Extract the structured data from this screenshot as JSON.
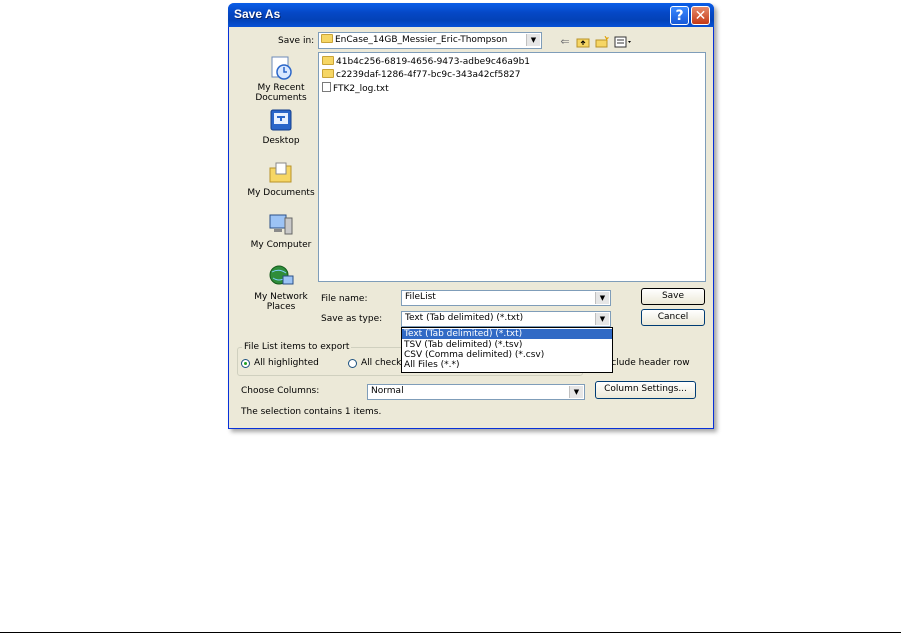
{
  "dialog": {
    "title": "Save As",
    "help_glyph": "?",
    "close_glyph": "✕"
  },
  "toolbar": {
    "save_in_label": "Save in:",
    "save_in_value": "EnCase_14GB_Messier_Eric-Thompson",
    "back_icon": "back-arrow-icon",
    "up_icon": "up-folder-icon",
    "new_folder_icon": "new-folder-icon",
    "views_icon": "views-menu-icon"
  },
  "places": [
    {
      "label": "My Recent Documents",
      "icon": "recent-documents-icon"
    },
    {
      "label": "Desktop",
      "icon": "desktop-icon"
    },
    {
      "label": "My Documents",
      "icon": "my-documents-icon"
    },
    {
      "label": "My Computer",
      "icon": "my-computer-icon"
    },
    {
      "label": "My Network Places",
      "icon": "network-places-icon"
    }
  ],
  "files": [
    {
      "name": "41b4c256-6819-4656-9473-adbe9c46a9b1",
      "type": "folder"
    },
    {
      "name": "c2239daf-1286-4f77-bc9c-343a42cf5827",
      "type": "folder"
    },
    {
      "name": "FTK2_log.txt",
      "type": "text"
    }
  ],
  "file_name": {
    "label": "File name:",
    "value": "FileList"
  },
  "save_as_type": {
    "label": "Save as type:",
    "value": "Text (Tab delimited) (*.txt)",
    "options": [
      "Text (Tab delimited) (*.txt)",
      "TSV (Tab delimited) (*.tsv)",
      "CSV (Comma delimited) (*.csv)",
      "All Files (*.*)"
    ],
    "selected_index": 0
  },
  "buttons": {
    "save": "Save",
    "cancel": "Cancel",
    "column_settings": "Column Settings..."
  },
  "export_group": {
    "legend": "File List items to export",
    "radio_highlighted": "All highlighted",
    "radio_checked": "All checke",
    "include_header": "Include header row"
  },
  "columns": {
    "label": "Choose Columns:",
    "value": "Normal"
  },
  "status": "The selection contains 1 items."
}
